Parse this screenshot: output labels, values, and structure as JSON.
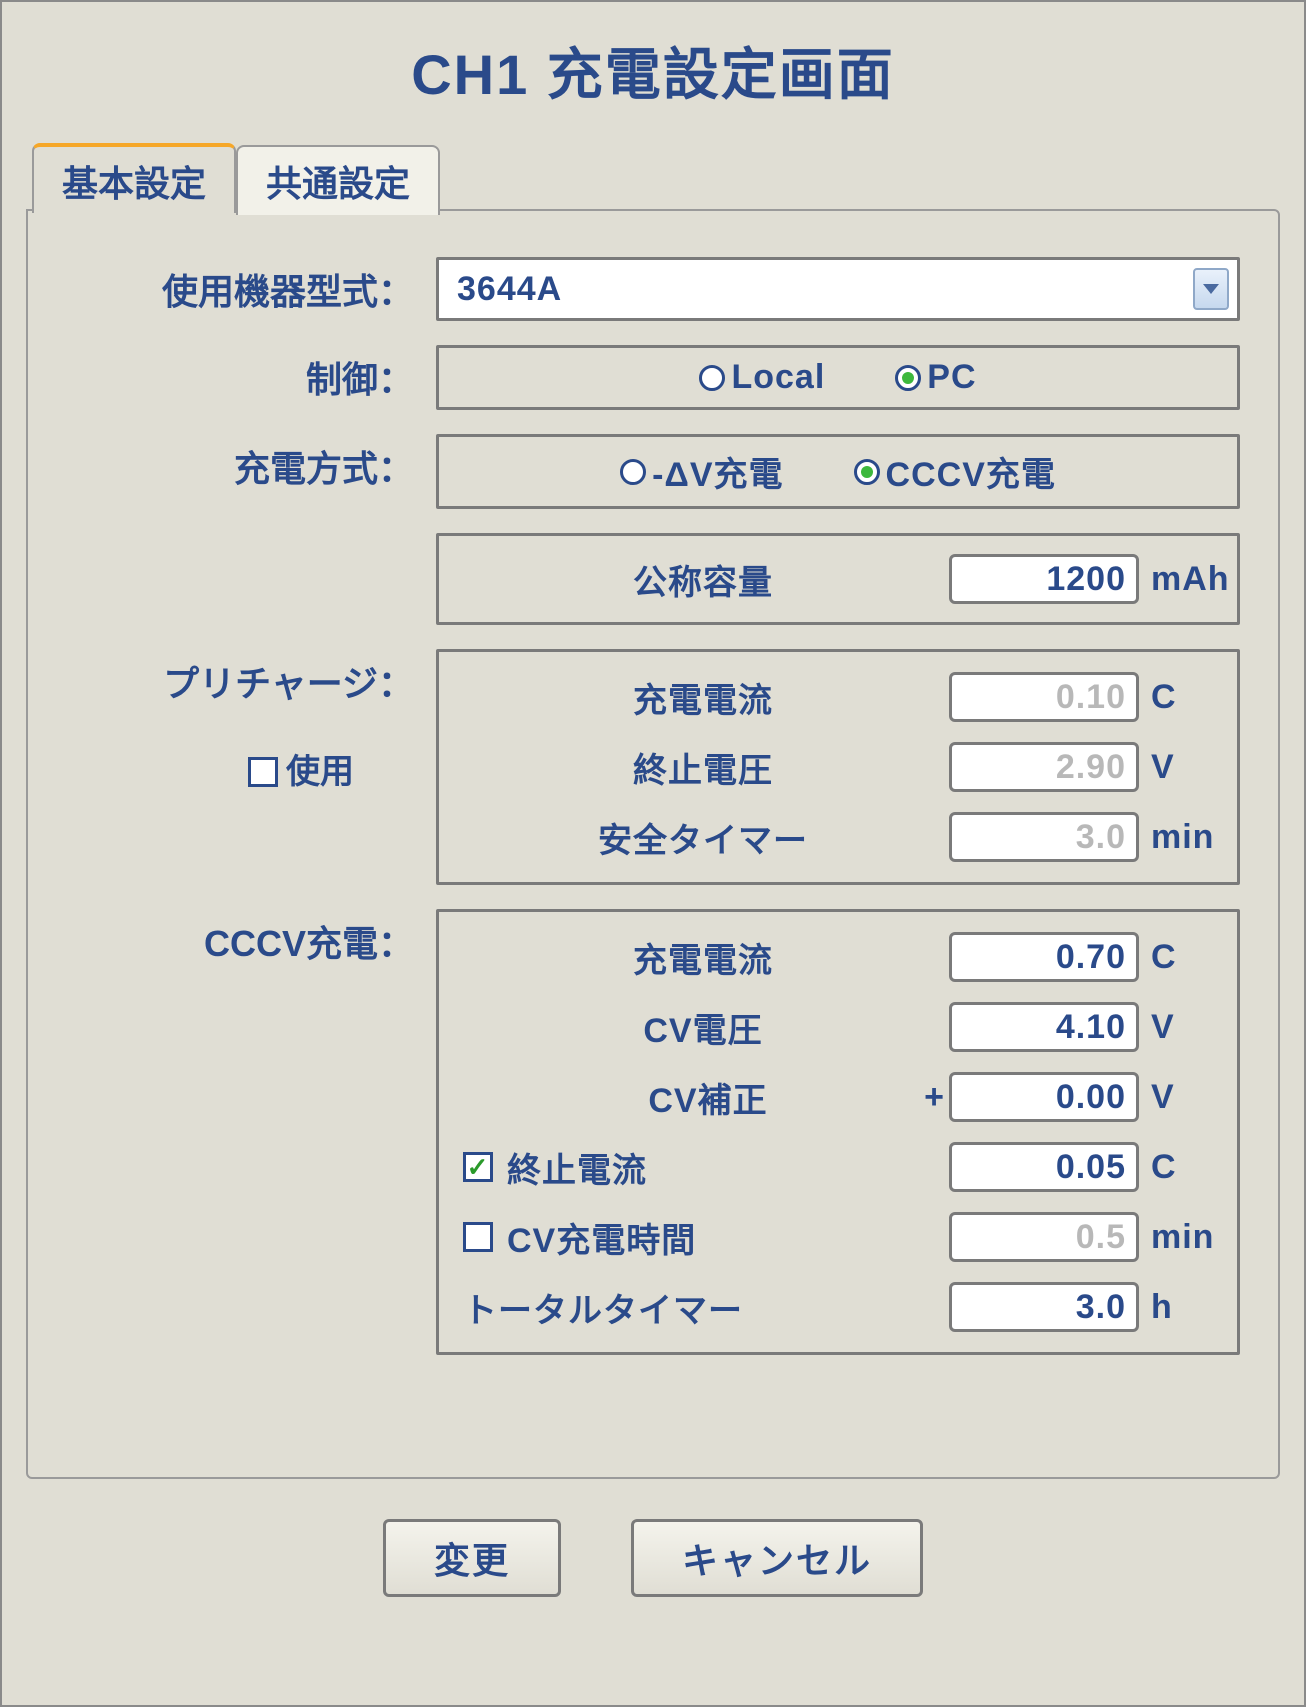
{
  "title": "CH1 充電設定画面",
  "tabs": {
    "basic": "基本設定",
    "common": "共通設定"
  },
  "labels": {
    "device_model": "使用機器型式：",
    "control": "制御：",
    "charge_method": "充電方式：",
    "precharge": "プリチャージ：",
    "precharge_use": "使用",
    "cccv": "CCCV充電："
  },
  "device": {
    "selected": "3644A"
  },
  "control": {
    "local": "Local",
    "pc": "PC",
    "selected": "pc"
  },
  "charge_method": {
    "dv": "-ΔV充電",
    "cccv": "CCCV充電",
    "selected": "cccv"
  },
  "nominal": {
    "label": "公称容量",
    "value": "1200",
    "unit": "mAh"
  },
  "precharge": {
    "use_checked": false,
    "current": {
      "label": "充電電流",
      "value": "0.10",
      "unit": "C"
    },
    "end_voltage": {
      "label": "終止電圧",
      "value": "2.90",
      "unit": "V"
    },
    "safety_timer": {
      "label": "安全タイマー",
      "value": "3.0",
      "unit": "min"
    }
  },
  "cccv": {
    "current": {
      "label": "充電電流",
      "value": "0.70",
      "unit": "C"
    },
    "cv_voltage": {
      "label": "CV電圧",
      "value": "4.10",
      "unit": "V"
    },
    "cv_correction": {
      "label": "CV補正",
      "prefix": "+",
      "value": "0.00",
      "unit": "V"
    },
    "end_current": {
      "checked": true,
      "label": "終止電流",
      "value": "0.05",
      "unit": "C"
    },
    "cv_time": {
      "checked": false,
      "label": "CV充電時間",
      "value": "0.5",
      "unit": "min"
    },
    "total_timer": {
      "label": "トータルタイマー",
      "value": "3.0",
      "unit": "h"
    }
  },
  "buttons": {
    "apply": "変更",
    "cancel": "キャンセル"
  }
}
